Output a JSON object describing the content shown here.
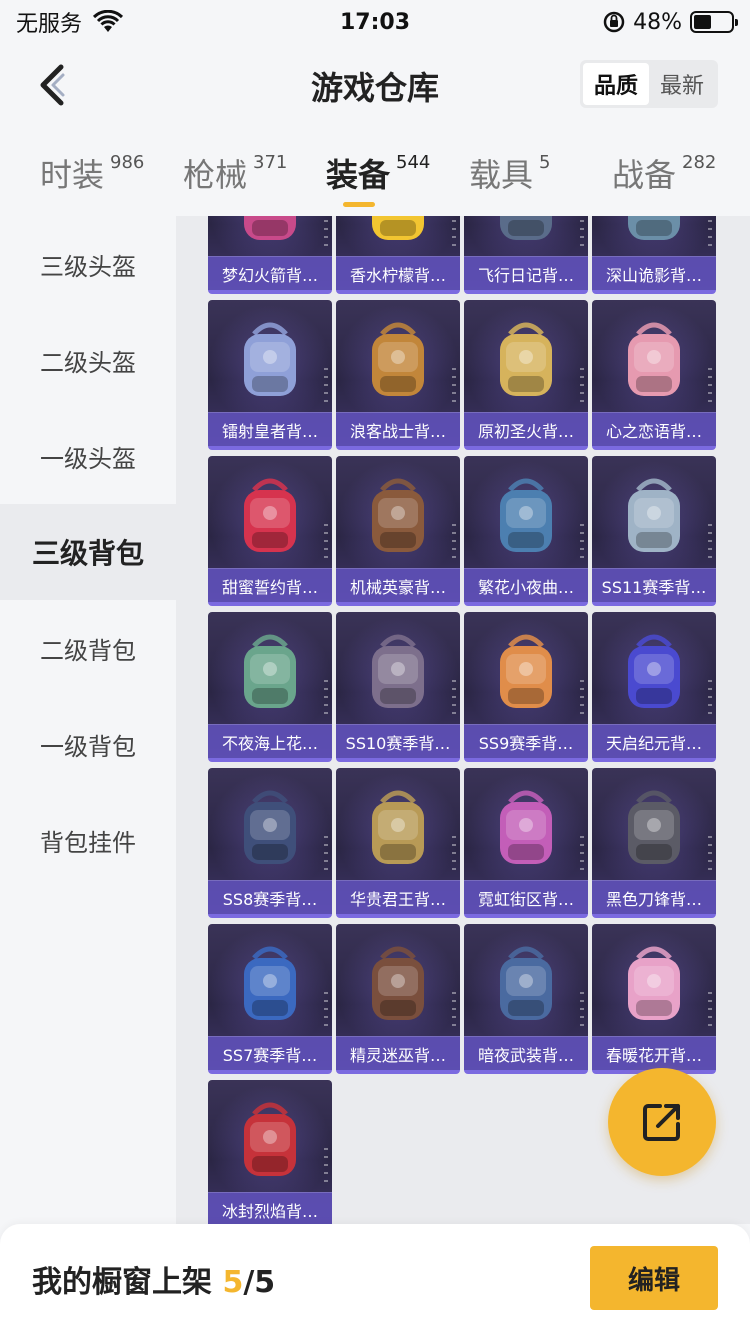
{
  "status_bar": {
    "carrier": "无服务",
    "time": "17:03",
    "battery": "48%",
    "battery_level": 0.48,
    "icons": [
      "wifi-icon",
      "orientation-lock-icon",
      "battery-icon"
    ]
  },
  "header": {
    "title": "游戏仓库",
    "back_icon": "chevron-left-icon",
    "sort_options": [
      "品质",
      "最新"
    ],
    "sort_selected": "品质"
  },
  "tabs": [
    {
      "label": "时装",
      "count": "986"
    },
    {
      "label": "枪械",
      "count": "371"
    },
    {
      "label": "装备",
      "count": "544"
    },
    {
      "label": "载具",
      "count": "5"
    },
    {
      "label": "战备",
      "count": "282"
    }
  ],
  "active_tab": "装备",
  "sidebar": {
    "items": [
      "三级头盔",
      "二级头盔",
      "一级头盔",
      "三级背包",
      "二级背包",
      "一级背包",
      "背包挂件"
    ],
    "active": "三级背包"
  },
  "items": [
    {
      "name": "梦幻火箭背…",
      "color": "#c84a8a"
    },
    {
      "name": "香水柠檬背…",
      "color": "#f2c531"
    },
    {
      "name": "飞行日记背…",
      "color": "#5a6c8a"
    },
    {
      "name": "深山诡影背…",
      "color": "#6b8fa8"
    },
    {
      "name": "镭射皇者背…",
      "color": "#8fa0d8"
    },
    {
      "name": "浪客战士背…",
      "color": "#c2863a"
    },
    {
      "name": "原初圣火背…",
      "color": "#d6b35c"
    },
    {
      "name": "心之恋语背…",
      "color": "#e69ab0"
    },
    {
      "name": "甜蜜誓约背…",
      "color": "#d6334e"
    },
    {
      "name": "机械英豪背…",
      "color": "#8a5a3c"
    },
    {
      "name": "繁花小夜曲…",
      "color": "#4c7fb0"
    },
    {
      "name": "SS11赛季背…",
      "color": "#9fb3c6"
    },
    {
      "name": "不夜海上花…",
      "color": "#6aa58c"
    },
    {
      "name": "SS10赛季背…",
      "color": "#7d6f8c"
    },
    {
      "name": "SS9赛季背…",
      "color": "#e08d4a"
    },
    {
      "name": "天启纪元背…",
      "color": "#4a4ad0"
    },
    {
      "name": "SS8赛季背…",
      "color": "#3f4f7a"
    },
    {
      "name": "华贵君王背…",
      "color": "#b89a56"
    },
    {
      "name": "霓虹街区背…",
      "color": "#c35eb8"
    },
    {
      "name": "黑色刀锋背…",
      "color": "#5b5b66"
    },
    {
      "name": "SS7赛季背…",
      "color": "#3b69c0"
    },
    {
      "name": "精灵迷巫背…",
      "color": "#7a4f3d"
    },
    {
      "name": "暗夜武装背…",
      "color": "#4a6aa0"
    },
    {
      "name": "春暖花开背…",
      "color": "#e8a2c8"
    },
    {
      "name": "冰封烈焰背…",
      "color": "#c6323a"
    }
  ],
  "fab_icon": "share-icon",
  "bottom_bar": {
    "label": "我的橱窗上架",
    "current": "5",
    "total": "/5",
    "edit_label": "编辑"
  },
  "colors": {
    "accent": "#f4b62e",
    "card_bg": "#2b2645",
    "card_label": "#6252be"
  }
}
